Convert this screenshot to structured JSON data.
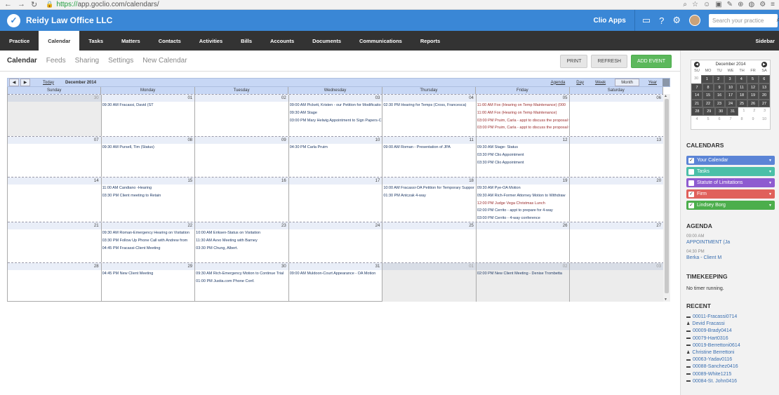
{
  "browser": {
    "url_proto": "https://",
    "url_rest": "app.goclio.com/calendars/"
  },
  "header": {
    "app_name": "Reidy Law Office LLC",
    "clio_apps": "Clio Apps",
    "search_placeholder": "Search your practice"
  },
  "nav": {
    "items": [
      "Practice",
      "Calendar",
      "Tasks",
      "Matters",
      "Contacts",
      "Activities",
      "Bills",
      "Accounts",
      "Documents",
      "Communications",
      "Reports"
    ],
    "active": "Calendar",
    "sidebar": "Sidebar"
  },
  "subtabs": {
    "items": [
      "Calendar",
      "Feeds",
      "Sharing",
      "Settings",
      "New Calendar"
    ],
    "active": "Calendar"
  },
  "actions": {
    "print": "PRINT",
    "refresh": "REFRESH",
    "add_event": "ADD EVENT"
  },
  "calendar": {
    "today": "Today",
    "month_label": "December 2014",
    "views": [
      "Agenda",
      "Day",
      "Week",
      "Month",
      "Year"
    ],
    "active_view": "Month",
    "days_of_week": [
      "Sunday",
      "Monday",
      "Tuesday",
      "Wednesday",
      "Thursday",
      "Friday",
      "Saturday"
    ],
    "weeks": [
      [
        {
          "num": "30",
          "muted": true,
          "events": []
        },
        {
          "num": "01",
          "events": [
            {
              "t": "09:30 AM Fracassi, David (ST"
            }
          ]
        },
        {
          "num": "02",
          "events": []
        },
        {
          "num": "03",
          "events": [
            {
              "t": "09:00 AM Pickett, Kristen - our Petition for Modificatio"
            },
            {
              "t": "09:30 AM Stage"
            },
            {
              "t": "03:00 PM Mary Helwig Appointment to Sign Papers-C"
            }
          ]
        },
        {
          "num": "04",
          "events": [
            {
              "t": "02:30 PM Hearing for Temps (Cross, Francesca)"
            }
          ]
        },
        {
          "num": "05",
          "events": [
            {
              "t": "11:00 AM Fox (Hearing on Temp Maintenance) (000",
              "red": true
            },
            {
              "t": "11:00 AM Fox (Hearing on Temp Maintenance)",
              "red": true
            },
            {
              "t": "03:00 PM Pruim, Carla - appt to discuss the proposal t",
              "red": true
            },
            {
              "t": "03:00 PM Pruim, Carla - appt to discuss the proposal t",
              "red": true
            }
          ]
        },
        {
          "num": "06",
          "events": []
        }
      ],
      [
        {
          "num": "07",
          "events": []
        },
        {
          "num": "08",
          "events": [
            {
              "t": "09:30 AM Pursell, Tim (Status)"
            }
          ]
        },
        {
          "num": "09",
          "events": []
        },
        {
          "num": "10",
          "events": [
            {
              "t": "04:30 PM Carla Pruim"
            }
          ]
        },
        {
          "num": "11",
          "events": [
            {
              "t": "09:00 AM Roman - Presentation of JPA"
            }
          ]
        },
        {
          "num": "12",
          "events": [
            {
              "t": "09:30 AM Stage- Status"
            },
            {
              "t": "03:30 PM Clio Appointment"
            },
            {
              "t": "03:30 PM Clio Appointment"
            }
          ]
        },
        {
          "num": "13",
          "events": []
        }
      ],
      [
        {
          "num": "14",
          "events": []
        },
        {
          "num": "15",
          "events": [
            {
              "t": "11:00 AM Candiano -Hearing"
            },
            {
              "t": "03:30 PM Client meeting to Retain"
            }
          ]
        },
        {
          "num": "16",
          "events": []
        },
        {
          "num": "17",
          "events": []
        },
        {
          "num": "18",
          "events": [
            {
              "t": "10:00 AM Fracassi-OA Petition for Temporary Suppor"
            },
            {
              "t": "01:30 PM Antczak 4-way"
            }
          ]
        },
        {
          "num": "19",
          "events": [
            {
              "t": "09:30 AM Pye-OA Motion"
            },
            {
              "t": "09:30 AM Rich-Former Attorney Motion to Withdraw"
            },
            {
              "t": "12:00 PM Judge Vega Christmas Lunch",
              "red": true
            },
            {
              "t": "02:00 PM Cerrito - appt to prepare for 4-way"
            },
            {
              "t": "03:00 PM Cerrito - 4-way conference"
            }
          ]
        },
        {
          "num": "20",
          "events": []
        }
      ],
      [
        {
          "num": "21",
          "events": []
        },
        {
          "num": "22",
          "events": [
            {
              "t": "09:30 AM Roman-Emergency Hearing on Visitation"
            },
            {
              "t": "03:30 PM Follow Up Phone Call with Andrew from"
            },
            {
              "t": "04:45 PM Fracassi-Client Meeting"
            }
          ]
        },
        {
          "num": "23",
          "events": [
            {
              "t": "10:00 AM Eriksen-Status on Visitation"
            },
            {
              "t": "11:30 AM Avvo Meeting with Barney"
            },
            {
              "t": "03:30 PM Chung, Albert."
            }
          ]
        },
        {
          "num": "24",
          "events": []
        },
        {
          "num": "25",
          "events": []
        },
        {
          "num": "26",
          "events": []
        },
        {
          "num": "27",
          "events": []
        }
      ],
      [
        {
          "num": "28",
          "events": []
        },
        {
          "num": "29",
          "events": [
            {
              "t": "04:45 PM New Client Meeting"
            }
          ]
        },
        {
          "num": "30",
          "events": [
            {
              "t": "09:30 AM Rich-Emergency Motion to Continue Trial"
            },
            {
              "t": "01:00 PM Justia.com Phone Conf."
            }
          ]
        },
        {
          "num": "31",
          "events": [
            {
              "t": "09:00 AM Muldoon-Court Appearance - OA Motion"
            }
          ]
        },
        {
          "num": "01",
          "muted": true,
          "events": []
        },
        {
          "num": "02",
          "muted": true,
          "events": [
            {
              "t": "02:00 PM New Client Meeting - Denise Trombetta"
            }
          ]
        },
        {
          "num": "03",
          "muted": true,
          "events": []
        }
      ]
    ]
  },
  "mini_calendar": {
    "title": "December 2014",
    "dow": [
      "SU",
      "MO",
      "TU",
      "WE",
      "TH",
      "FR",
      "SA"
    ],
    "rows": [
      [
        [
          "30",
          "out"
        ],
        [
          "1",
          "in"
        ],
        [
          "2",
          "in"
        ],
        [
          "3",
          "in"
        ],
        [
          "4",
          "in"
        ],
        [
          "5",
          "in"
        ],
        [
          "6",
          "in"
        ]
      ],
      [
        [
          "7",
          "in"
        ],
        [
          "8",
          "in"
        ],
        [
          "9",
          "in"
        ],
        [
          "10",
          "in"
        ],
        [
          "11",
          "in"
        ],
        [
          "12",
          "in"
        ],
        [
          "13",
          "in"
        ]
      ],
      [
        [
          "14",
          "in"
        ],
        [
          "15",
          "in"
        ],
        [
          "16",
          "in"
        ],
        [
          "17",
          "in"
        ],
        [
          "18",
          "in"
        ],
        [
          "19",
          "in"
        ],
        [
          "20",
          "in"
        ]
      ],
      [
        [
          "21",
          "in"
        ],
        [
          "22",
          "in"
        ],
        [
          "23",
          "in"
        ],
        [
          "24",
          "in"
        ],
        [
          "25",
          "in"
        ],
        [
          "26",
          "in"
        ],
        [
          "27",
          "in"
        ]
      ],
      [
        [
          "28",
          "in"
        ],
        [
          "29",
          "in"
        ],
        [
          "30",
          "in"
        ],
        [
          "31",
          "in"
        ],
        [
          "1",
          "out"
        ],
        [
          "2",
          "out"
        ],
        [
          "3",
          "out"
        ]
      ],
      [
        [
          "4",
          "out"
        ],
        [
          "5",
          "out"
        ],
        [
          "6",
          "out"
        ],
        [
          "7",
          "out"
        ],
        [
          "8",
          "out"
        ],
        [
          "9",
          "out"
        ],
        [
          "10",
          "out"
        ]
      ]
    ]
  },
  "sidebar": {
    "calendars_title": "CALENDARS",
    "calendars": [
      {
        "label": "Your Calendar",
        "color": "#5b84d6",
        "checked": true
      },
      {
        "label": "Tasks",
        "color": "#4bbfa8",
        "checked": false
      },
      {
        "label": "Statute of Limitations",
        "color": "#8e5bd0",
        "checked": false
      },
      {
        "label": "Firm",
        "color": "#e0605b",
        "checked": true
      },
      {
        "label": "Lindsey Borg",
        "color": "#4cae4c",
        "checked": true
      }
    ],
    "agenda_title": "AGENDA",
    "agenda": [
      {
        "time": "09:00 AM",
        "text": "APPOINTMENT (Ja"
      },
      {
        "time": "04:30 PM",
        "text": "Berka - Client M"
      }
    ],
    "timekeeping_title": "TIMEKEEPING",
    "timekeeping_text": "No timer running.",
    "recent_title": "RECENT",
    "recent": [
      {
        "icon": "matter",
        "text": "00011-Fracassi0714"
      },
      {
        "icon": "person",
        "text": "Devid Fracassi"
      },
      {
        "icon": "matter",
        "text": "00009-Brady0414"
      },
      {
        "icon": "matter",
        "text": "00079-Hart0316"
      },
      {
        "icon": "matter",
        "text": "00019-Berrettoni0614"
      },
      {
        "icon": "person",
        "text": "Christine Berrettoni"
      },
      {
        "icon": "matter",
        "text": "00063-Yadav0116"
      },
      {
        "icon": "matter",
        "text": "00088-Sanchez0416"
      },
      {
        "icon": "matter",
        "text": "00089-White1215"
      },
      {
        "icon": "matter",
        "text": "00084-St. John0416"
      }
    ]
  }
}
